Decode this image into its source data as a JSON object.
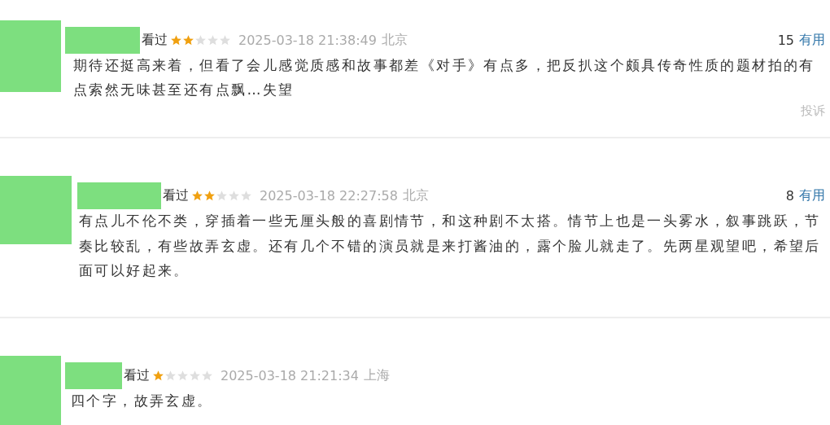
{
  "comments": [
    {
      "status": "看过",
      "stars": 2,
      "time": "2025-03-18 21:38:49",
      "location": "北京",
      "votes": "15",
      "vote_label": "有用",
      "lines": [
        "期待还挺高来着，但看了会儿感觉质感和故事都差《对手》有点多，把反扒这个颇具传奇性质的题材拍的有",
        "点索然无味甚至还有点飘…失望"
      ],
      "report": "投诉"
    },
    {
      "status": "看过",
      "stars": 2,
      "time": "2025-03-18 22:27:58",
      "location": "北京",
      "votes": "8",
      "vote_label": "有用",
      "lines": [
        "有点儿不伦不类，穿插着一些无厘头般的喜剧情节，和这种剧不太搭。情节上也是一头雾水，叙事跳跃，节",
        "奏比较乱，有些故弄玄虚。还有几个不错的演员就是来打酱油的，露个脸儿就走了。先两星观望吧，希望后",
        "面可以好起来。"
      ]
    },
    {
      "status": "看过",
      "stars": 1,
      "time": "2025-03-18 21:21:34",
      "location": "上海",
      "lines": [
        "四个字，故弄玄虚。"
      ]
    }
  ]
}
